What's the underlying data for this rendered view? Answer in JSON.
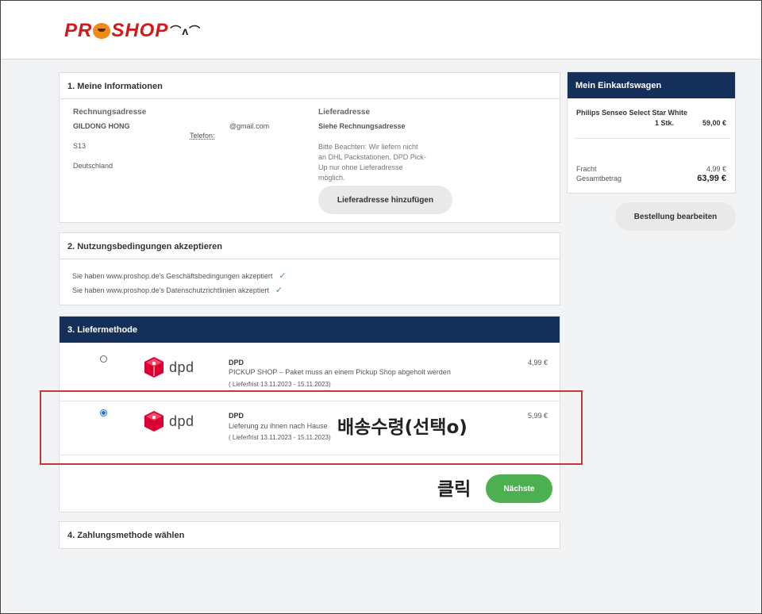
{
  "header": {
    "logo_text_a": "PR",
    "logo_text_b": "SHOP"
  },
  "section1": {
    "title": "1. Meine Informationen",
    "billing_label": "Rechnungsadresse",
    "billing_name": "GILDONG HONG",
    "email": "@gmail.com",
    "phone_label": "Telefon:",
    "street": "S13",
    "country": "Deutschland",
    "shipping_label": "Lieferadresse",
    "shipping_value": "Siehe Rechnungsadresse",
    "note_lines": [
      "Bitte Beachten: Wir liefern nicht",
      "an DHL Packstationen. DPD Pick-",
      "Up nur ohne Lieferadresse",
      "möglich."
    ],
    "add_address_button": "Lieferadresse hinzufügen"
  },
  "section2": {
    "title": "2. Nutzungsbedingungen akzeptieren",
    "items": [
      "Sie haben www.proshop.de's Geschäftsbedingungen akzeptiert",
      "Sie haben www.proshop.de's Datenschutzrichtlinien akzeptiert"
    ],
    "check_icon": "check-icon"
  },
  "section3": {
    "title": "3. Liefermethode",
    "options": [
      {
        "selected": false,
        "logo": "dpd",
        "name": "DPD",
        "desc": "PICKUP SHOP – Paket muss an einem Pickup Shop abgeholt werden",
        "period": "( Lieferfrist 13.11.2023 - 15.11.2023)",
        "price": "4,99 €"
      },
      {
        "selected": true,
        "logo": "dpd",
        "name": "DPD",
        "desc": "Lieferung zu ihnen nach Hause",
        "period": "( Lieferfrist 13.11.2023 - 15.11.2023)",
        "price": "5,99 €"
      }
    ],
    "annotation_select": "배송수령(선택o)",
    "annotation_click": "클릭",
    "next_button": "Nächste"
  },
  "section4": {
    "title": "4. Zahlungsmethode wählen"
  },
  "cart": {
    "title": "Mein Einkaufswagen",
    "product": "Philips Senseo Select Star White",
    "qty": "1 Stk.",
    "price": "59,00 €",
    "shipping_label": "Fracht",
    "shipping_value": "4,99 €",
    "total_label": "Gesamtbetrag",
    "total_value": "63,99 €",
    "edit_button": "Bestellung bearbeiten"
  },
  "colors": {
    "navy": "#14305a",
    "green": "#4caf50",
    "annotation_red": "#c8363a",
    "dpd_red": "#dc0032"
  }
}
